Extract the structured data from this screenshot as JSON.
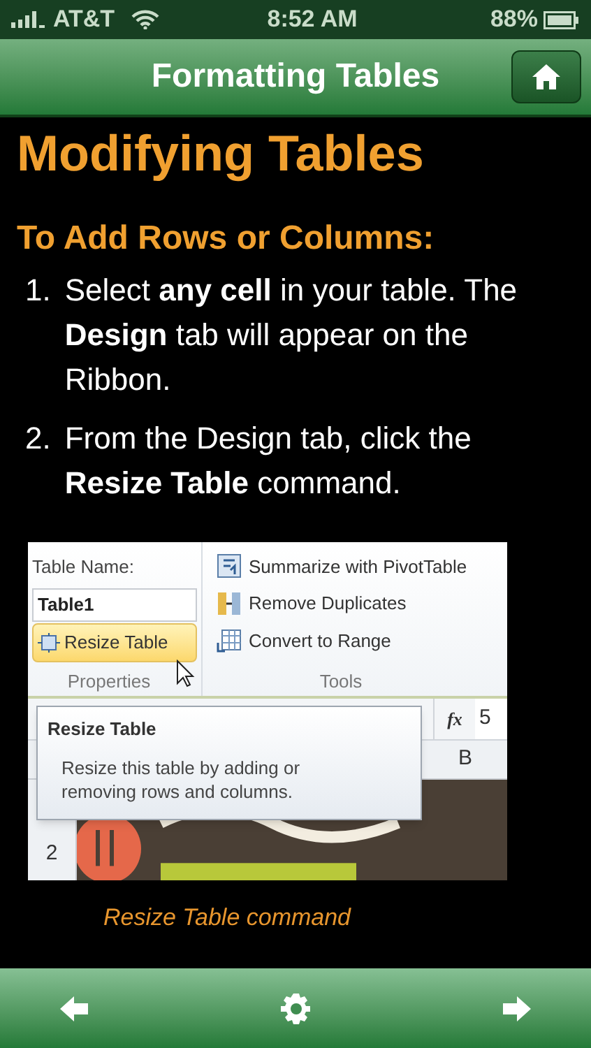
{
  "status_bar": {
    "carrier": "AT&T",
    "time": "8:52 AM",
    "battery": "88%"
  },
  "header": {
    "title": "Formatting Tables"
  },
  "heading": "Modifying Tables",
  "subheading": "To Add Rows or Columns:",
  "steps": [
    {
      "number": "1.",
      "text": "Select **any cell** in your table. The **Design** tab will appear on the Ribbon."
    },
    {
      "number": "2.",
      "text": "From the Design tab, click the **Resize Table** command."
    }
  ],
  "figure": {
    "ribbon": {
      "table_name_label": "Table Name:",
      "table_name_value": "Table1",
      "resize_button": {
        "label": "Resize Table",
        "highlighted": true
      },
      "properties_label": "Properties",
      "tools": [
        {
          "kind": "pivot",
          "label": "Summarize with PivotTable"
        },
        {
          "kind": "duplicates",
          "label": "Remove Duplicates"
        },
        {
          "kind": "range",
          "label": "Convert to Range"
        }
      ],
      "tools_label": "Tools"
    },
    "formula_bar": {
      "fx": "fx",
      "value": "5"
    },
    "column_header": "B",
    "row_numbers": [
      "2"
    ],
    "tooltip": {
      "title": "Resize Table",
      "description": "Resize this table by adding or removing rows and columns."
    }
  },
  "caption": "Resize Table command"
}
